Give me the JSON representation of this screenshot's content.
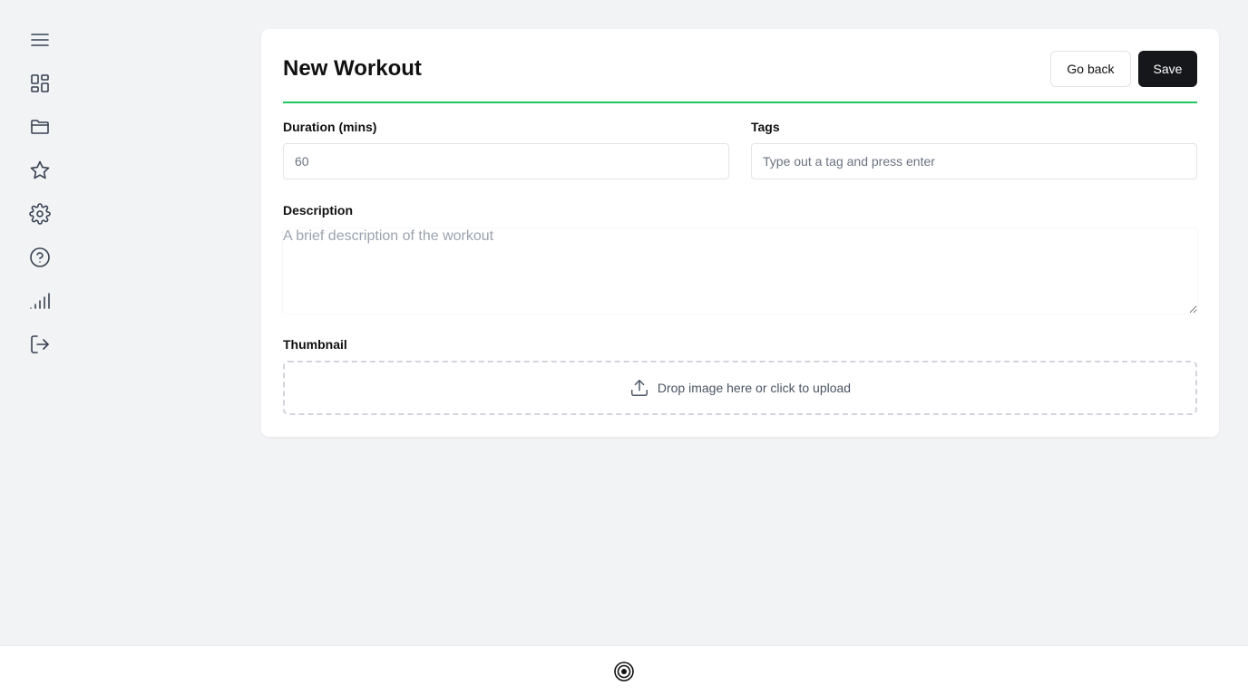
{
  "sidebar": {
    "items": [
      {
        "icon": "menu-icon"
      },
      {
        "icon": "dashboard-icon"
      },
      {
        "icon": "folder-icon"
      },
      {
        "icon": "star-icon"
      },
      {
        "icon": "settings-icon"
      },
      {
        "icon": "help-icon"
      },
      {
        "icon": "signal-icon"
      },
      {
        "icon": "logout-icon"
      }
    ]
  },
  "form": {
    "title": "New Workout",
    "go_back_label": "Go back",
    "save_label": "Save",
    "accent_color": "#22c55e",
    "duration": {
      "label": "Duration (mins)",
      "value": "",
      "placeholder": "60"
    },
    "tags": {
      "label": "Tags",
      "value": "",
      "placeholder": "Type out a tag and press enter"
    },
    "description": {
      "label": "Description",
      "value": "",
      "placeholder": "A brief description of the workout"
    },
    "thumbnail": {
      "label": "Thumbnail",
      "dropzone_text": "Drop image here or click to upload",
      "icon": "upload-icon"
    }
  },
  "footer": {
    "logo_icon": "target-logo-icon"
  }
}
